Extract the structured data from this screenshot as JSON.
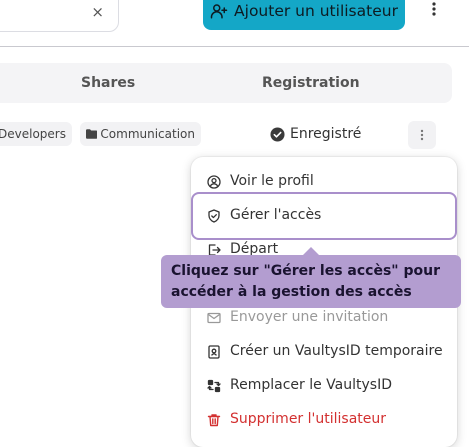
{
  "toolbar": {
    "clear_icon": "×",
    "add_user_label": "Ajouter un utilisateur",
    "accent_color": "#14a7c7"
  },
  "table": {
    "columns": {
      "shares": "Shares",
      "registration": "Registration"
    },
    "row": {
      "shares": [
        "Developers",
        "Communication"
      ],
      "registration": "Enregistré"
    }
  },
  "menu": {
    "items": [
      {
        "label": "Voir le profil",
        "icon": "user-circle-icon"
      },
      {
        "label": "Gérer l'accès",
        "icon": "shield-icon"
      },
      {
        "label": "Départ",
        "icon": "exit-icon"
      },
      {
        "label": "Envoyer une invitation",
        "icon": "mail-icon"
      },
      {
        "label": "Créer un VaultysID temporaire",
        "icon": "id-card-icon"
      },
      {
        "label": "Remplacer le VaultysID",
        "icon": "swap-icon"
      },
      {
        "label": "Supprimer l'utilisateur",
        "icon": "trash-icon"
      }
    ]
  },
  "tooltip": {
    "line1": "Cliquez sur \"Gérer les accès\" pour",
    "line2": "accéder à la gestion des accès",
    "color": "#b39dd0"
  }
}
